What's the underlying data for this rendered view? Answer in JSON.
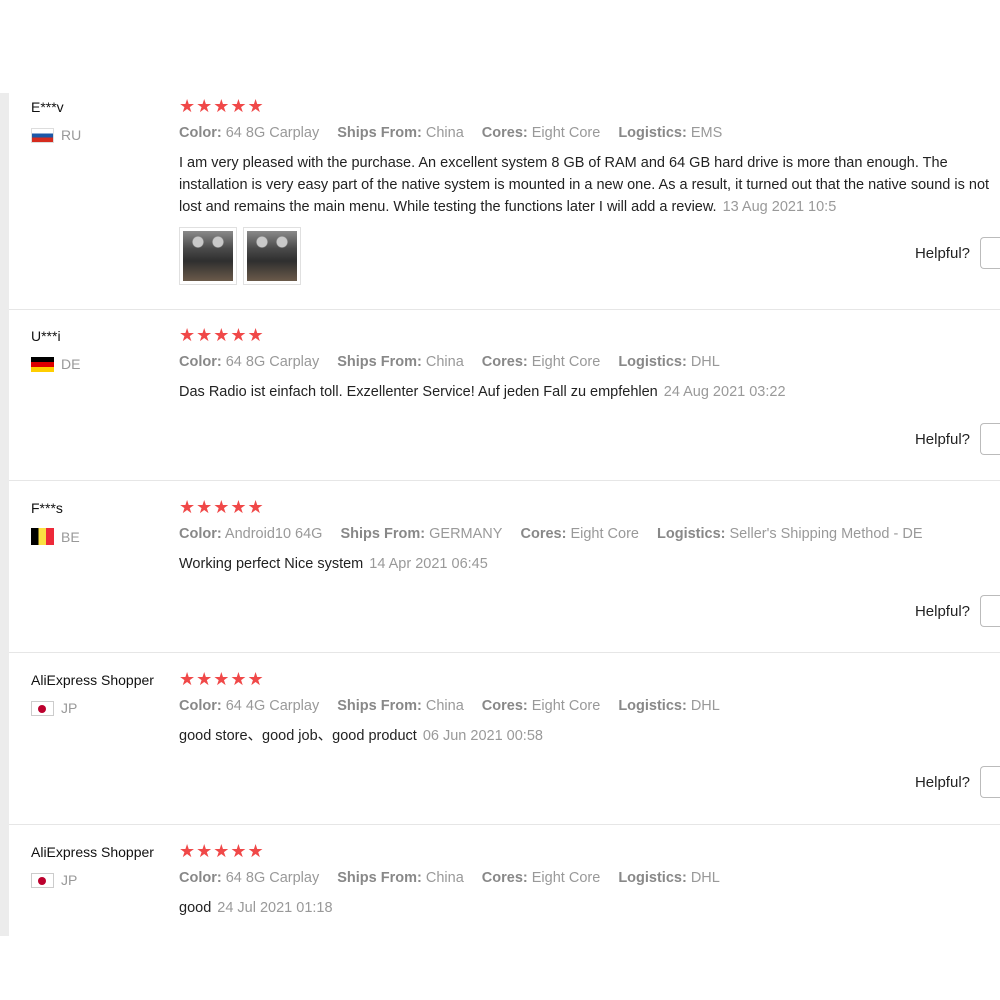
{
  "reviews": [
    {
      "user": "E***v",
      "country": "RU",
      "stars": "★★★★★",
      "attrs": [
        {
          "label": "Color:",
          "value": "64 8G Carplay"
        },
        {
          "label": "Ships From:",
          "value": "China"
        },
        {
          "label": "Cores:",
          "value": "Eight Core"
        },
        {
          "label": "Logistics:",
          "value": "EMS"
        }
      ],
      "text": "I am very pleased with the purchase. An excellent system 8 GB of RAM and 64 GB hard drive is more than enough. The installation is very easy part of the native system is mounted in a new one. As a result, it turned out that the native sound is not lost and remains the main menu. While testing the functions later I will add a review.",
      "date": "13 Aug 2021 10:5",
      "helpful_label": "Helpful?"
    },
    {
      "user": "U***i",
      "country": "DE",
      "stars": "★★★★★",
      "attrs": [
        {
          "label": "Color:",
          "value": "64 8G Carplay"
        },
        {
          "label": "Ships From:",
          "value": "China"
        },
        {
          "label": "Cores:",
          "value": "Eight Core"
        },
        {
          "label": "Logistics:",
          "value": "DHL"
        }
      ],
      "text": "Das Radio ist einfach toll. Exzellenter Service! Auf jeden Fall zu empfehlen",
      "date": "24 Aug 2021 03:22",
      "helpful_label": "Helpful?"
    },
    {
      "user": "F***s",
      "country": "BE",
      "stars": "★★★★★",
      "attrs": [
        {
          "label": "Color:",
          "value": "Android10 64G"
        },
        {
          "label": "Ships From:",
          "value": "GERMANY"
        },
        {
          "label": "Cores:",
          "value": "Eight Core"
        },
        {
          "label": "Logistics:",
          "value": "Seller's Shipping Method - DE"
        }
      ],
      "text": "Working perfect Nice system",
      "date": "14 Apr 2021 06:45",
      "helpful_label": "Helpful?"
    },
    {
      "user": "AliExpress Shopper",
      "country": "JP",
      "stars": "★★★★★",
      "attrs": [
        {
          "label": "Color:",
          "value": "64 4G Carplay"
        },
        {
          "label": "Ships From:",
          "value": "China"
        },
        {
          "label": "Cores:",
          "value": "Eight Core"
        },
        {
          "label": "Logistics:",
          "value": "DHL"
        }
      ],
      "text": "good store、good job、good product",
      "date": "06 Jun 2021 00:58",
      "helpful_label": "Helpful?"
    },
    {
      "user": "AliExpress Shopper",
      "country": "JP",
      "stars": "★★★★★",
      "attrs": [
        {
          "label": "Color:",
          "value": "64 8G Carplay"
        },
        {
          "label": "Ships From:",
          "value": "China"
        },
        {
          "label": "Cores:",
          "value": "Eight Core"
        },
        {
          "label": "Logistics:",
          "value": "DHL"
        }
      ],
      "text": "good",
      "date": "24 Jul 2021 01:18"
    }
  ],
  "colors": {
    "star": "#f04848",
    "muted": "#999999",
    "divider": "#e6e6e6"
  }
}
